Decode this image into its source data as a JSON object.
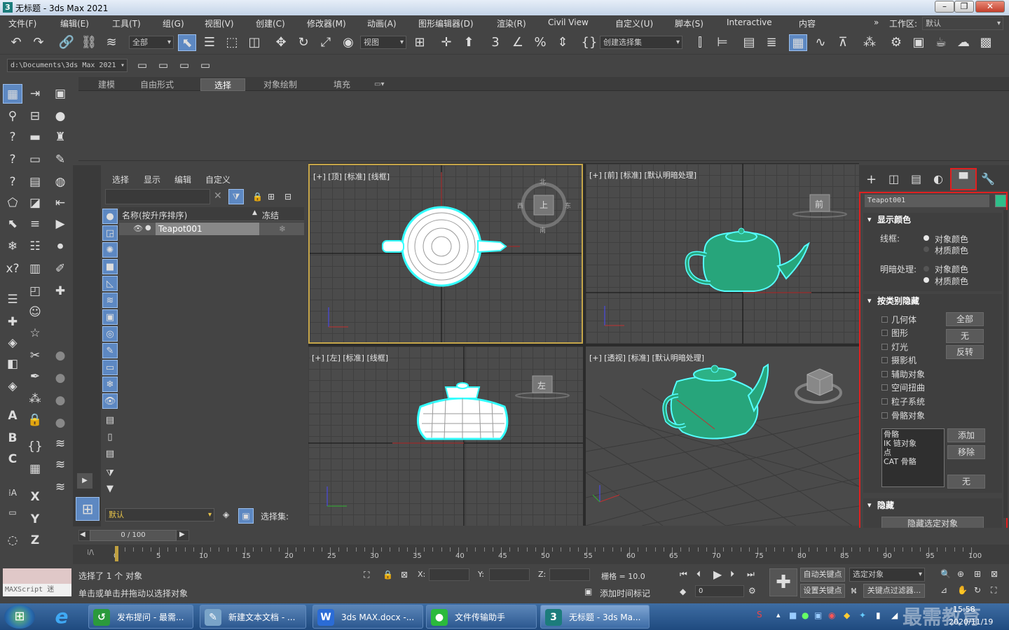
{
  "window": {
    "title": "无标题 - 3ds Max 2021",
    "icon": "3"
  },
  "menu": [
    "文件(F)",
    "编辑(E)",
    "工具(T)",
    "组(G)",
    "视图(V)",
    "创建(C)",
    "修改器(M)",
    "动画(A)",
    "图形编辑器(D)",
    "渲染(R)",
    "Civil View",
    "自定义(U)",
    "脚本(S)",
    "Interactive",
    "内容"
  ],
  "workspace": {
    "label": "工作区:",
    "value": "默认"
  },
  "toolbar": {
    "filter": "全部",
    "ref_coord": "视图",
    "selection_set": "创建选择集"
  },
  "project_path": "d:\\Documents\\3ds Max 2021",
  "ribbon_tabs": [
    "建模",
    "自由形式",
    "选择",
    "对象绘制",
    "填充"
  ],
  "ribbon_active": "选择",
  "scene_explorer": {
    "tabs": [
      "选择",
      "显示",
      "编辑",
      "自定义"
    ],
    "col_name": "名称(按升序排序)",
    "col_frozen": "冻结",
    "object": "Teapot001",
    "layer": "默认",
    "selection_set_label": "选择集:"
  },
  "viewports": {
    "top": "[+] [顶] [标准] [线框]",
    "front": "[+] [前] [标准] [默认明暗处理]",
    "left": "[+] [左] [标准] [线框]",
    "perspective": "[+] [透视] [标准] [默认明暗处理]"
  },
  "viewcube": {
    "top_face": "上",
    "north": "北",
    "south": "南",
    "west": "西",
    "east": "东",
    "front_face": "前",
    "left_face": "左"
  },
  "display_panel": {
    "object_name": "Teapot001",
    "object_color": "#2fbf8a",
    "display_color": {
      "title": "显示颜色",
      "wireframe_label": "线框:",
      "shaded_label": "明暗处理:",
      "opt_object": "对象颜色",
      "opt_material": "材质颜色",
      "wireframe_selected": "对象颜色",
      "shaded_selected": "材质颜色"
    },
    "hide_by_category": {
      "title": "按类别隐藏",
      "items": [
        "几何体",
        "图形",
        "灯光",
        "摄影机",
        "辅助对象",
        "空间扭曲",
        "粒子系统",
        "骨骼对象"
      ],
      "buttons": [
        "全部",
        "无",
        "反转"
      ],
      "list": [
        "骨骼",
        "IK 链对象",
        "点",
        "CAT 骨骼"
      ],
      "list_buttons": [
        "添加",
        "移除",
        "无"
      ]
    },
    "hide": {
      "title": "隐藏",
      "button": "隐藏选定对象"
    }
  },
  "timeline": {
    "counter": "0 / 100",
    "ticks": [
      0,
      5,
      10,
      15,
      20,
      25,
      30,
      35,
      40,
      45,
      50,
      55,
      60,
      65,
      70,
      75,
      80,
      85,
      90,
      95,
      100
    ]
  },
  "status": {
    "maxscript": "MAXScript 迷",
    "selected": "选择了 1 个 对象",
    "hint": "单击或单击并拖动以选择对象",
    "x_label": "X:",
    "y_label": "Y:",
    "z_label": "Z:",
    "grid": "栅格 = 10.0",
    "add_time_tag": "添加时间标记",
    "auto_key": "自动关键点",
    "selected_object": "选定对象",
    "set_key": "设置关键点",
    "key_filter": "关键点过滤器...",
    "frame": "0"
  },
  "taskbar": {
    "items": [
      "发布提问 - 最需...",
      "新建文本文档 - ...",
      "3ds MAX.docx -...",
      "文件传输助手",
      "无标题 - 3ds Ma..."
    ],
    "time": "15:58",
    "date": "2020/11/19",
    "watermark": "最需教育"
  }
}
